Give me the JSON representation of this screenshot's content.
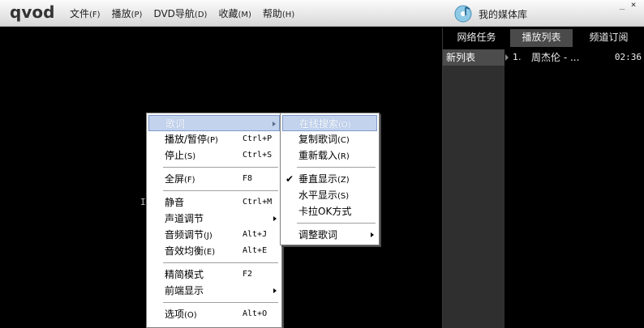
{
  "app": {
    "logo_text": "qvod",
    "menu": [
      {
        "label": "文件",
        "accel": "(F)"
      },
      {
        "label": "播放",
        "accel": "(P)"
      },
      {
        "label": "DVD导航",
        "accel": "(D)"
      },
      {
        "label": "收藏",
        "accel": "(M)"
      },
      {
        "label": "帮助",
        "accel": "(H)"
      }
    ],
    "media_library": "我的媒体库",
    "win_controls": {
      "minimize": "_",
      "close": "×"
    }
  },
  "panel": {
    "tabs": [
      "网络任务",
      "播放列表",
      "频道订阅"
    ],
    "active_tab": "播放列表",
    "list_name": "新列表",
    "tracks": [
      {
        "index": "1.",
        "title": "周杰伦 - ...",
        "duration": "02:36"
      }
    ]
  },
  "video": {
    "stray_text": "I"
  },
  "context_menu": {
    "items": [
      {
        "label": "歌词",
        "shortcut": "",
        "submenu": true
      },
      {
        "label": "播放/暂停",
        "accel": "(P)",
        "shortcut": "Ctrl+P"
      },
      {
        "label": "停止",
        "accel": "(S)",
        "shortcut": "Ctrl+S"
      },
      {
        "label": "全屏",
        "accel": "(F)",
        "shortcut": "F8"
      },
      {
        "label": "静音",
        "shortcut": "Ctrl+M"
      },
      {
        "label": "声道调节",
        "shortcut": "",
        "submenu": true
      },
      {
        "label": "音频调节",
        "accel": "(J)",
        "shortcut": "Alt+J"
      },
      {
        "label": "音效均衡",
        "accel": "(E)",
        "shortcut": "Alt+E"
      },
      {
        "label": "精简模式",
        "shortcut": "F2"
      },
      {
        "label": "前端显示",
        "shortcut": "",
        "submenu": true
      },
      {
        "label": "选项",
        "accel": "(O)",
        "shortcut": "Alt+O"
      }
    ]
  },
  "lyrics_submenu": {
    "items": [
      {
        "label": "在线搜索",
        "accel": "(O)"
      },
      {
        "label": "复制歌词",
        "accel": "(C)"
      },
      {
        "label": "重新载入",
        "accel": "(R)"
      },
      {
        "label": "垂直显示",
        "accel": "(Z)",
        "checked": true
      },
      {
        "label": "水平显示",
        "accel": "(S)"
      },
      {
        "label": "卡拉OK方式",
        "accel": ""
      },
      {
        "label": "调整歌词",
        "accel": "",
        "submenu": true
      }
    ],
    "check_mark": "✔"
  }
}
